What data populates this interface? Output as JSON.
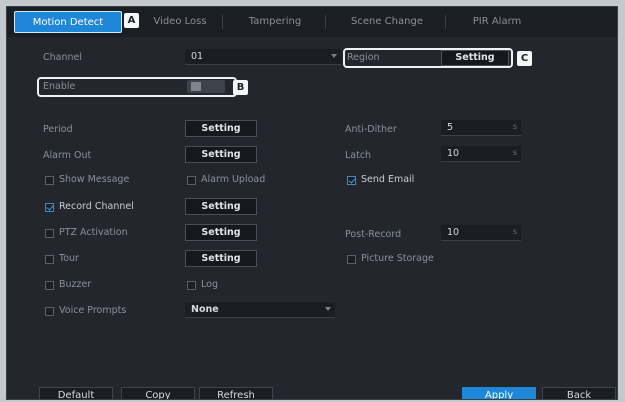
{
  "tabs": [
    {
      "label": "Motion Detect",
      "callout": "A"
    },
    {
      "label": "Video Loss"
    },
    {
      "label": "Tampering"
    },
    {
      "label": "Scene Change"
    },
    {
      "label": "PIR Alarm"
    }
  ],
  "channel": {
    "label": "Channel",
    "value": "01"
  },
  "region": {
    "label": "Region",
    "button": "Setting",
    "callout": "C"
  },
  "enable": {
    "label": "Enable",
    "callout": "B"
  },
  "period": {
    "label": "Period",
    "button": "Setting"
  },
  "alarm_out": {
    "label": "Alarm Out",
    "button": "Setting"
  },
  "anti_dither": {
    "label": "Anti-Dither",
    "value": "5",
    "unit": "s"
  },
  "latch": {
    "label": "Latch",
    "value": "10",
    "unit": "s"
  },
  "show_message": {
    "label": "Show Message",
    "checked": false
  },
  "alarm_upload": {
    "label": "Alarm Upload",
    "checked": false
  },
  "send_email": {
    "label": "Send Email",
    "checked": true
  },
  "record_channel": {
    "label": "Record Channel",
    "checked": true,
    "button": "Setting"
  },
  "ptz_activation": {
    "label": "PTZ Activation",
    "checked": false,
    "button": "Setting"
  },
  "post_record": {
    "label": "Post-Record",
    "value": "10",
    "unit": "s"
  },
  "tour": {
    "label": "Tour",
    "checked": false,
    "button": "Setting"
  },
  "picture_storage": {
    "label": "Picture Storage",
    "checked": false
  },
  "buzzer": {
    "label": "Buzzer",
    "checked": false
  },
  "log": {
    "label": "Log",
    "checked": false
  },
  "voice_prompts": {
    "label": "Voice Prompts",
    "checked": false,
    "value": "None"
  },
  "footer": {
    "default": "Default",
    "copy": "Copy",
    "refresh": "Refresh",
    "apply": "Apply",
    "back": "Back"
  },
  "colors": {
    "accent": "#1f87d8",
    "background": "#23272d",
    "tabbar": "#1b1e23"
  }
}
